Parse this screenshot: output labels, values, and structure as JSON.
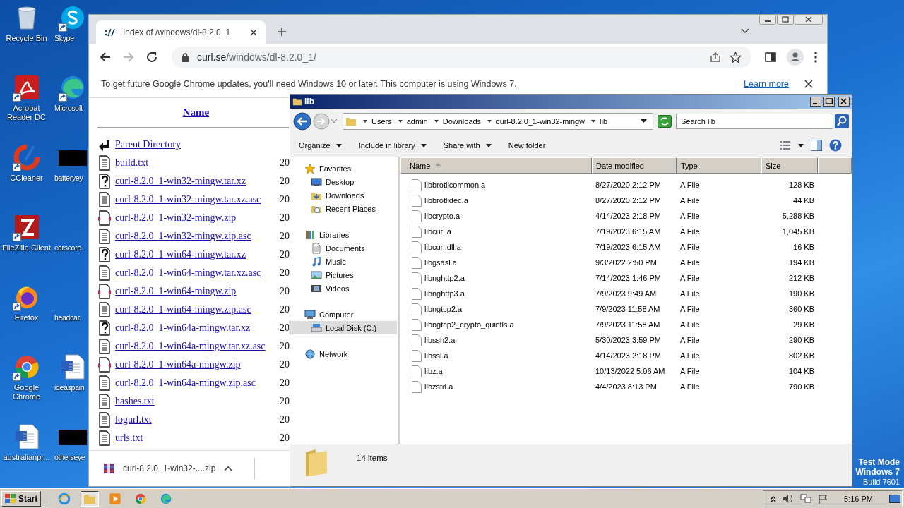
{
  "desktop": {
    "icon_columns": [
      {
        "icons": [
          {
            "label": "Recycle Bin",
            "kind": "recycle",
            "shortcut": false
          },
          {
            "label": "Acrobat Reader DC",
            "kind": "acrobat",
            "shortcut": true
          },
          {
            "label": "CCleaner",
            "kind": "ccleaner",
            "shortcut": true
          },
          {
            "label": "FileZilla Client",
            "kind": "filezilla",
            "shortcut": true
          },
          {
            "label": "Firefox",
            "kind": "firefox",
            "shortcut": true
          },
          {
            "label": "Google Chrome",
            "kind": "chrome",
            "shortcut": true
          },
          {
            "label": "australianpr...",
            "kind": "word",
            "shortcut": false
          }
        ]
      },
      {
        "icons": [
          {
            "label": "Skype",
            "kind": "skype",
            "shortcut": true
          },
          {
            "label": "Microsoft",
            "kind": "edge",
            "shortcut": true
          },
          {
            "label": "batteryey",
            "kind": "thumbnail",
            "shortcut": false
          },
          {
            "label": "carscore.",
            "kind": "none",
            "shortcut": false
          },
          {
            "label": "headcar.",
            "kind": "none",
            "shortcut": false
          },
          {
            "label": "ideaspain",
            "kind": "word",
            "shortcut": false
          },
          {
            "label": "otherseye",
            "kind": "thumbnail",
            "shortcut": false
          }
        ]
      }
    ],
    "os_notice": [
      "Test Mode",
      "Windows 7",
      "Build 7601"
    ]
  },
  "browser": {
    "tab": {
      "title": "Index of /windows/dl-8.2.0_1"
    },
    "nav": {
      "back_disabled": false,
      "forward_disabled": true
    },
    "address": {
      "domain": "curl.se",
      "path": "/windows/dl-8.2.0_1/"
    },
    "infobar": {
      "message": "To get future Google Chrome updates, you'll need Windows 10 or later. This computer is using Windows 7.",
      "link": "Learn more"
    },
    "listing": {
      "heading": "Name",
      "rows": [
        {
          "name": "Parent Directory",
          "kind": "parent"
        },
        {
          "name": "build.txt",
          "kind": "text",
          "date": "20"
        },
        {
          "name": "curl-8.2.0_1-win32-mingw.tar.xz",
          "kind": "unknown",
          "date": "20"
        },
        {
          "name": "curl-8.2.0_1-win32-mingw.tar.xz.asc",
          "kind": "text",
          "date": "20"
        },
        {
          "name": "curl-8.2.0_1-win32-mingw.zip",
          "kind": "compressed",
          "date": "20"
        },
        {
          "name": "curl-8.2.0_1-win32-mingw.zip.asc",
          "kind": "text",
          "date": "20"
        },
        {
          "name": "curl-8.2.0_1-win64-mingw.tar.xz",
          "kind": "unknown",
          "date": "20"
        },
        {
          "name": "curl-8.2.0_1-win64-mingw.tar.xz.asc",
          "kind": "text",
          "date": "20"
        },
        {
          "name": "curl-8.2.0_1-win64-mingw.zip",
          "kind": "compressed",
          "date": "20"
        },
        {
          "name": "curl-8.2.0_1-win64-mingw.zip.asc",
          "kind": "text",
          "date": "20"
        },
        {
          "name": "curl-8.2.0_1-win64a-mingw.tar.xz",
          "kind": "unknown",
          "date": "20"
        },
        {
          "name": "curl-8.2.0_1-win64a-mingw.tar.xz.asc",
          "kind": "text",
          "date": "20"
        },
        {
          "name": "curl-8.2.0_1-win64a-mingw.zip",
          "kind": "compressed",
          "date": "20"
        },
        {
          "name": "curl-8.2.0_1-win64a-mingw.zip.asc",
          "kind": "text",
          "date": "20"
        },
        {
          "name": "hashes.txt",
          "kind": "text",
          "date": "20"
        },
        {
          "name": "logurl.txt",
          "kind": "text",
          "date": "20"
        },
        {
          "name": "urls.txt",
          "kind": "text",
          "date": "20"
        }
      ]
    },
    "download": {
      "filename": "curl-8.2.0_1-win32-....zip"
    }
  },
  "explorer": {
    "title": "lib",
    "breadcrumb": [
      "Users",
      "admin",
      "Downloads",
      "curl-8.2.0_1-win32-mingw",
      "lib"
    ],
    "search": {
      "placeholder": "Search lib"
    },
    "toolbar": [
      {
        "label": "Organize",
        "menu": true
      },
      {
        "label": "Include in library",
        "menu": true
      },
      {
        "label": "Share with",
        "menu": true
      },
      {
        "label": "New folder",
        "menu": false
      }
    ],
    "nav": [
      {
        "label": "Favorites",
        "kind": "star",
        "selected": false,
        "children": [
          {
            "label": "Desktop",
            "kind": "desktop",
            "selected": false
          },
          {
            "label": "Downloads",
            "kind": "downloads",
            "selected": false
          },
          {
            "label": "Recent Places",
            "kind": "recent",
            "selected": false
          }
        ]
      },
      {
        "label": "Libraries",
        "kind": "libraries",
        "selected": false,
        "children": [
          {
            "label": "Documents",
            "kind": "documents",
            "selected": false
          },
          {
            "label": "Music",
            "kind": "music",
            "selected": false
          },
          {
            "label": "Pictures",
            "kind": "pictures",
            "selected": false
          },
          {
            "label": "Videos",
            "kind": "videos",
            "selected": false
          }
        ]
      },
      {
        "label": "Computer",
        "kind": "computer",
        "selected": false,
        "children": [
          {
            "label": "Local Disk (C:)",
            "kind": "disk",
            "selected": true
          }
        ]
      },
      {
        "label": "Network",
        "kind": "network",
        "selected": false
      }
    ],
    "columns": [
      {
        "label": "Name",
        "sorted": true
      },
      {
        "label": "Date modified",
        "sorted": false
      },
      {
        "label": "Type",
        "sorted": false
      },
      {
        "label": "Size",
        "sorted": false
      }
    ],
    "files": [
      {
        "name": "libbrotlicommon.a",
        "date": "8/27/2020 2:12 PM",
        "type": "A File",
        "size": "128 KB"
      },
      {
        "name": "libbrotlidec.a",
        "date": "8/27/2020 2:12 PM",
        "type": "A File",
        "size": "44 KB"
      },
      {
        "name": "libcrypto.a",
        "date": "4/14/2023 2:18 PM",
        "type": "A File",
        "size": "5,288 KB"
      },
      {
        "name": "libcurl.a",
        "date": "7/19/2023 6:15 AM",
        "type": "A File",
        "size": "1,045 KB"
      },
      {
        "name": "libcurl.dll.a",
        "date": "7/19/2023 6:15 AM",
        "type": "A File",
        "size": "16 KB"
      },
      {
        "name": "libgsasl.a",
        "date": "9/3/2022 2:50 PM",
        "type": "A File",
        "size": "194 KB"
      },
      {
        "name": "libnghttp2.a",
        "date": "7/14/2023 1:46 PM",
        "type": "A File",
        "size": "212 KB"
      },
      {
        "name": "libnghttp3.a",
        "date": "7/9/2023 9:49 AM",
        "type": "A File",
        "size": "190 KB"
      },
      {
        "name": "libngtcp2.a",
        "date": "7/9/2023 11:58 AM",
        "type": "A File",
        "size": "360 KB"
      },
      {
        "name": "libngtcp2_crypto_quictls.a",
        "date": "7/9/2023 11:58 AM",
        "type": "A File",
        "size": "29 KB"
      },
      {
        "name": "libssh2.a",
        "date": "5/30/2023 3:59 PM",
        "type": "A File",
        "size": "290 KB"
      },
      {
        "name": "libssl.a",
        "date": "4/14/2023 2:18 PM",
        "type": "A File",
        "size": "802 KB"
      },
      {
        "name": "libz.a",
        "date": "10/13/2022 5:06 AM",
        "type": "A File",
        "size": "104 KB"
      },
      {
        "name": "libzstd.a",
        "date": "4/4/2023 8:13 PM",
        "type": "A File",
        "size": "790 KB"
      }
    ],
    "status": "14 items"
  },
  "taskbar": {
    "start": "Start",
    "apps": [
      {
        "kind": "ie",
        "active": false
      },
      {
        "kind": "folder",
        "active": true
      },
      {
        "kind": "media",
        "active": false
      },
      {
        "kind": "chrome",
        "active": false
      },
      {
        "kind": "edge",
        "active": false
      }
    ],
    "clock": "5:16 PM"
  }
}
